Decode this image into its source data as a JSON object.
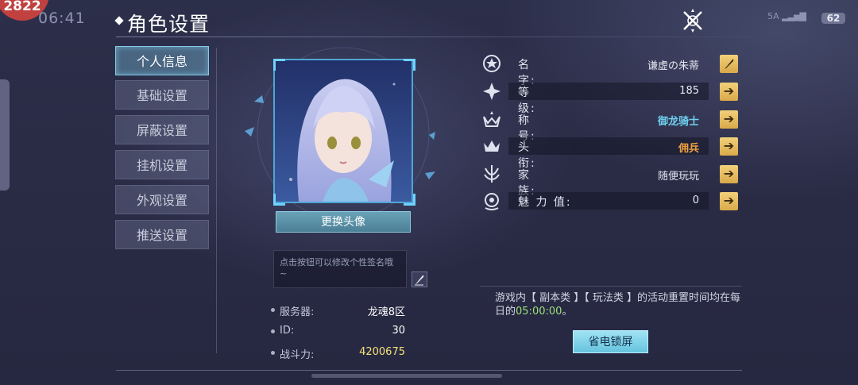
{
  "status": {
    "time": "06:41",
    "badge": "2822",
    "signal": "5A",
    "battery": "62"
  },
  "header": {
    "title": "角色设置"
  },
  "menu": {
    "items": [
      {
        "label": "个人信息",
        "active": true
      },
      {
        "label": "基础设置",
        "active": false
      },
      {
        "label": "屏蔽设置",
        "active": false
      },
      {
        "label": "挂机设置",
        "active": false
      },
      {
        "label": "外观设置",
        "active": false
      },
      {
        "label": "推送设置",
        "active": false
      }
    ]
  },
  "profile": {
    "change_avatar_label": "更换头像",
    "signature_placeholder": "点击按钮可以修改个性签名哦~",
    "server_label": "服务器:",
    "server_value": "龙魂8区",
    "id_label": "ID:",
    "id_value": "30",
    "power_label": "战斗力:",
    "power_value": "4200675"
  },
  "stats": {
    "name_label": "名　　字:",
    "name_value": "谦虚の朱蒂",
    "level_label": "等　　级:",
    "level_value": "185",
    "title_label": "称　　号:",
    "title_value": "御龙骑士",
    "rank_label": "头　　衔:",
    "rank_value": "佣兵",
    "clan_label": "家　　族:",
    "clan_value": "随便玩玩",
    "charm_label": "魅 力 值:",
    "charm_value": "0"
  },
  "notice": {
    "text_before": "游戏内【 副本类 】【 玩法类 】的活动重置时间均在每日的",
    "time": "05:00:00",
    "text_after": "。"
  },
  "power_save_label": "省电锁屏",
  "colors": {
    "accent": "#86c9e6",
    "title_color": "#6fd0f0",
    "rank_color": "#f0a040",
    "reset_time_color": "#9be07a",
    "button_gold": "#e6bd5f"
  }
}
